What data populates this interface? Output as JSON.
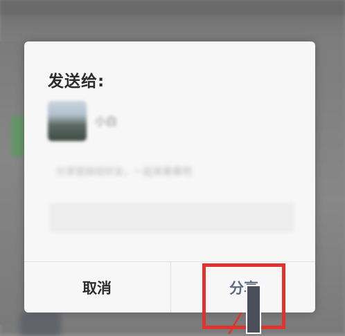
{
  "dialog": {
    "title": "发送给:",
    "contact_name": "小白",
    "preview_text": "分享链接给好友，一起来看看吧",
    "message_placeholder": "",
    "cancel_label": "取消",
    "share_label": "分享"
  },
  "colors": {
    "highlight": "#e0332d",
    "share_text": "#5e6b7e",
    "dialog_bg": "#f7f7f7"
  }
}
